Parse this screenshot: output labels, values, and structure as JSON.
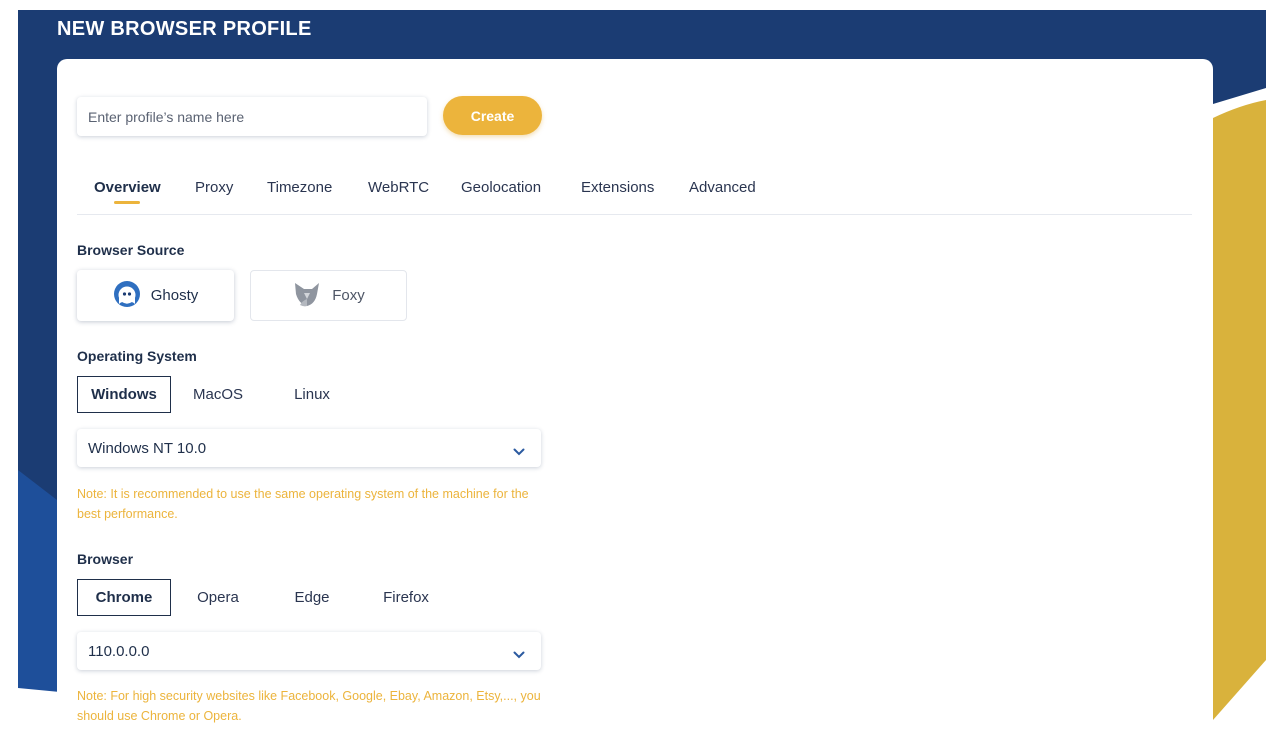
{
  "page": {
    "title": "NEW BROWSER PROFILE"
  },
  "colors": {
    "accent": "#ecb43c",
    "navy": "#1b3c73",
    "gold": "#d9b23c"
  },
  "profile": {
    "name_placeholder": "Enter profile’s name here",
    "name_value": "",
    "create_label": "Create"
  },
  "tabs": [
    {
      "label": "Overview",
      "active": true
    },
    {
      "label": "Proxy"
    },
    {
      "label": "Timezone"
    },
    {
      "label": "WebRTC"
    },
    {
      "label": "Geolocation"
    },
    {
      "label": "Extensions"
    },
    {
      "label": "Advanced"
    }
  ],
  "browser_source": {
    "label": "Browser Source",
    "options": [
      {
        "label": "Ghosty",
        "icon": "ghost-logo-icon",
        "selected": true
      },
      {
        "label": "Foxy",
        "icon": "fox-logo-icon",
        "selected": false
      }
    ]
  },
  "os": {
    "label": "Operating System",
    "options": [
      "Windows",
      "MacOS",
      "Linux"
    ],
    "selected": "Windows",
    "version": "Windows NT 10.0",
    "note": "Note: It is recommended to use the same operating system of the machine for the best performance."
  },
  "browser": {
    "label": "Browser",
    "options": [
      "Chrome",
      "Opera",
      "Edge",
      "Firefox"
    ],
    "selected": "Chrome",
    "version": "110.0.0.0",
    "note": "Note: For high security websites like Facebook, Google, Ebay, Amazon, Etsy,..., you should use Chrome or Opera."
  }
}
